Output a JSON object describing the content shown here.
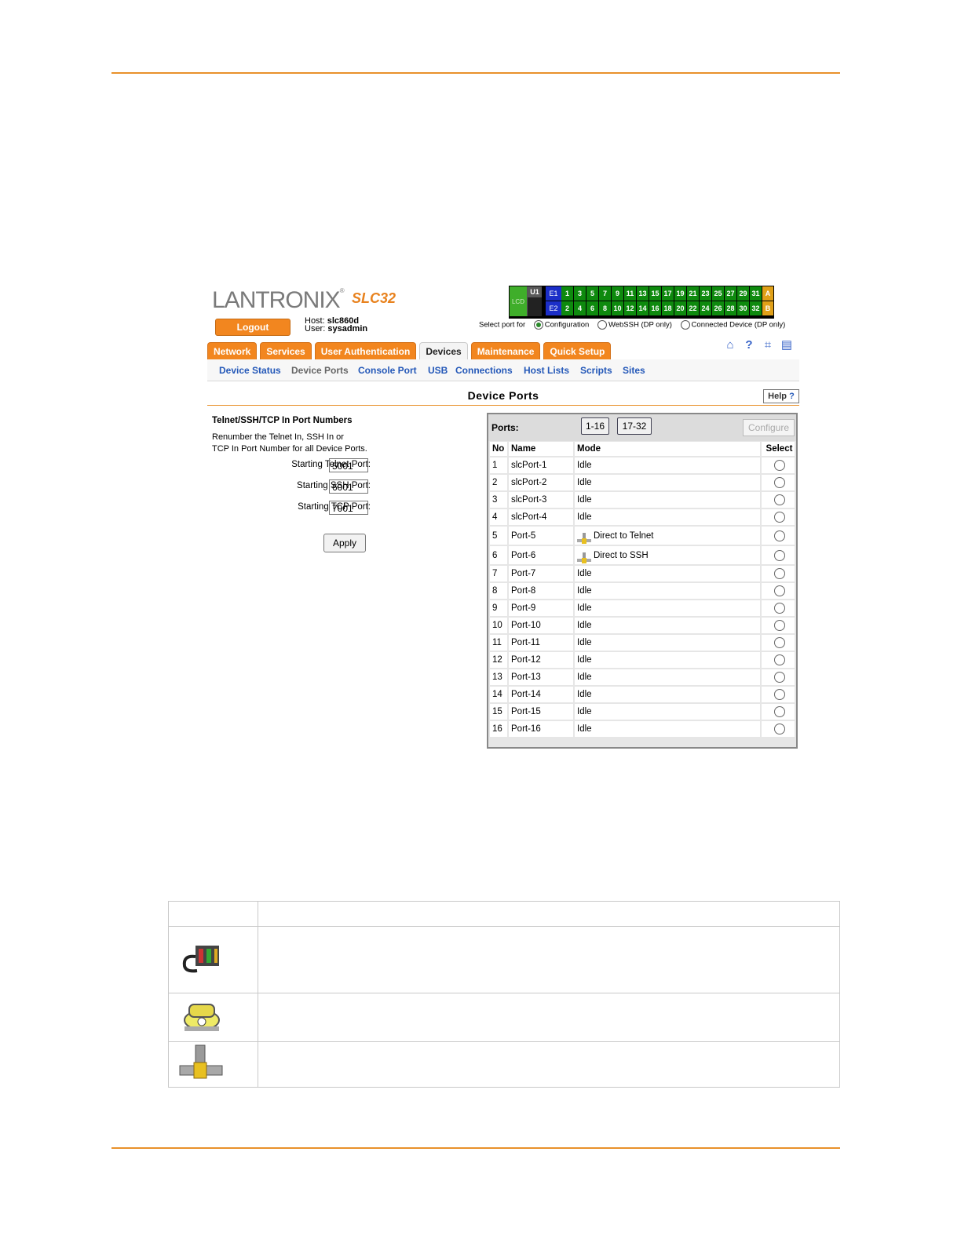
{
  "logo": {
    "brand": "LANTRONIX",
    "model": "SLC32"
  },
  "header": {
    "logout_label": "Logout",
    "host_label": "Host:",
    "host": "slc860d",
    "user_label": "User:",
    "user": "sysadmin"
  },
  "portmap": {
    "lcd": "LCD",
    "u1": "U1",
    "e1": "E1",
    "e2": "E2",
    "top": [
      "1",
      "3",
      "5",
      "7",
      "9",
      "11",
      "13",
      "15",
      "17",
      "19",
      "21",
      "23",
      "25",
      "27",
      "29",
      "31"
    ],
    "bottom": [
      "2",
      "4",
      "6",
      "8",
      "10",
      "12",
      "14",
      "16",
      "18",
      "20",
      "22",
      "24",
      "26",
      "28",
      "30",
      "32"
    ],
    "a": "A",
    "b": "B",
    "select_for": "Select port for",
    "opt_config": "Configuration",
    "opt_webssh": "WebSSH (DP only)",
    "opt_connected": "Connected Device (DP only)"
  },
  "tabs": [
    "Network",
    "Services",
    "User Authentication",
    "Devices",
    "Maintenance",
    "Quick Setup"
  ],
  "icons": [
    "home-icon",
    "help-icon",
    "sitemap-icon",
    "log-icon"
  ],
  "subnav": [
    "Device Status",
    "Device Ports",
    "Console Port",
    "USB",
    "Connections",
    "Host Lists",
    "Scripts",
    "Sites"
  ],
  "page": {
    "title": "Device Ports",
    "help_label": "Help"
  },
  "form": {
    "heading": "Telnet/SSH/TCP In Port Numbers",
    "desc1": "Renumber the Telnet In, SSH In or",
    "desc2": "TCP In Port Number for all Device Ports.",
    "telnet_label": "Starting Telnet Port:",
    "telnet_value": "5001",
    "ssh_label": "Starting SSH Port:",
    "ssh_value": "6001",
    "tcp_label": "Starting TCP Port:",
    "tcp_value": "7001",
    "apply_label": "Apply"
  },
  "ports": {
    "label": "Ports:",
    "range1": "1-16",
    "range2": "17-32",
    "configure_label": "Configure",
    "headers": [
      "No",
      "Name",
      "Mode",
      "Select"
    ],
    "rows": [
      {
        "no": "1",
        "name": "slcPort-1",
        "mode": "Idle"
      },
      {
        "no": "2",
        "name": "slcPort-2",
        "mode": "Idle"
      },
      {
        "no": "3",
        "name": "slcPort-3",
        "mode": "Idle"
      },
      {
        "no": "4",
        "name": "slcPort-4",
        "mode": "Idle"
      },
      {
        "no": "5",
        "name": "Port-5",
        "mode": "Direct to Telnet"
      },
      {
        "no": "6",
        "name": "Port-6",
        "mode": "Direct to SSH"
      },
      {
        "no": "7",
        "name": "Port-7",
        "mode": "Idle"
      },
      {
        "no": "8",
        "name": "Port-8",
        "mode": "Idle"
      },
      {
        "no": "9",
        "name": "Port-9",
        "mode": "Idle"
      },
      {
        "no": "10",
        "name": "Port-10",
        "mode": "Idle"
      },
      {
        "no": "11",
        "name": "Port-11",
        "mode": "Idle"
      },
      {
        "no": "12",
        "name": "Port-12",
        "mode": "Idle"
      },
      {
        "no": "13",
        "name": "Port-13",
        "mode": "Idle"
      },
      {
        "no": "14",
        "name": "Port-14",
        "mode": "Idle"
      },
      {
        "no": "15",
        "name": "Port-15",
        "mode": "Idle"
      },
      {
        "no": "16",
        "name": "Port-16",
        "mode": "Idle"
      }
    ]
  },
  "legend": {
    "icons": [
      "modem-icon",
      "dialup-phone-icon",
      "direct-connect-icon"
    ]
  },
  "colors": {
    "accent": "#e8912b",
    "tab": "#f2861f",
    "link": "#2458b8",
    "port_green": "#0e8a0e"
  }
}
